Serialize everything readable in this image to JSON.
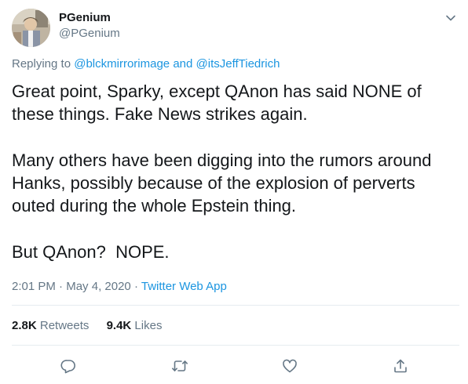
{
  "author": {
    "display_name": "PGenium",
    "handle": "@PGenium",
    "avatar_icon": "avatar-photo"
  },
  "menu": {
    "icon": "chevron-down-icon"
  },
  "replying": {
    "prefix": "Replying to",
    "user1": "@blckmirrorimage",
    "conj": "and",
    "user2": "@itsJeffTiedrich"
  },
  "body": {
    "p1_l1": "Great point, Sparky, except QAnon has said NONE of",
    "p1_l2": "these things. Fake News strikes again.",
    "p2_l1": "Many others have been digging into the rumors around",
    "p2_l2": "Hanks, possibly because of the explosion of perverts",
    "p2_l3": "outed during the whole Epstein thing.",
    "p3_l1": "But QAnon?  NOPE."
  },
  "meta": {
    "time": "2:01 PM",
    "sep1": "·",
    "date": "May 4, 2020",
    "sep2": "·",
    "source": "Twitter Web App"
  },
  "stats": {
    "retweets_count": "2.8K",
    "retweets_label": "Retweets",
    "likes_count": "9.4K",
    "likes_label": "Likes"
  },
  "actions": {
    "reply_icon": "reply-icon",
    "retweet_icon": "retweet-icon",
    "like_icon": "heart-icon",
    "share_icon": "share-icon"
  },
  "colors": {
    "link": "#1b95e0",
    "muted": "#657786",
    "text": "#14171a",
    "divider": "#e6ecf0"
  }
}
